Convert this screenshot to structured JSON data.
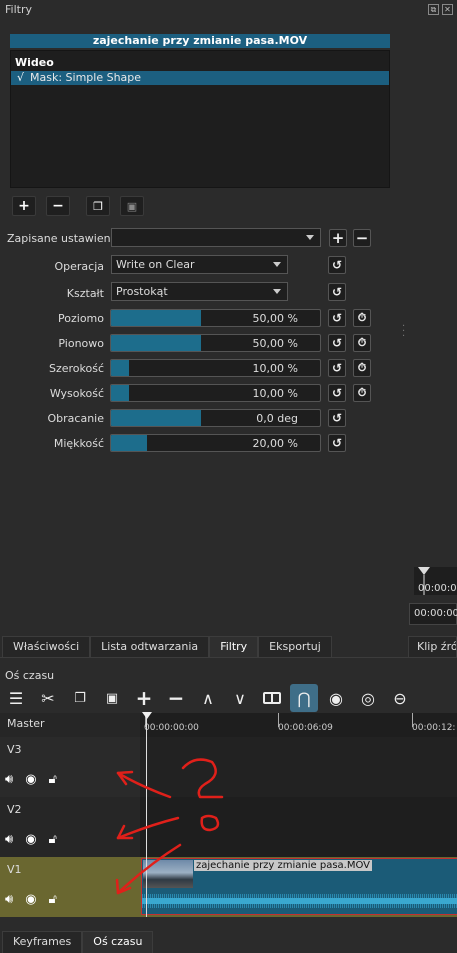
{
  "dock": {
    "title": "Filtry"
  },
  "clip_title": "zajechanie przy zmianie pasa.MOV",
  "filter_list": {
    "section": "Wideo",
    "items": [
      {
        "check": "√",
        "label": "Mask: Simple Shape"
      }
    ]
  },
  "presets": {
    "label": "Zapisane ustawienia",
    "value": ""
  },
  "params": {
    "operation": {
      "label": "Operacja",
      "value": "Write on Clear"
    },
    "shape": {
      "label": "Kształt",
      "value": "Prostokąt"
    },
    "sliders": [
      {
        "label": "Poziomo",
        "value": "50,00 %",
        "fraction": 0.5,
        "keyframe": true
      },
      {
        "label": "Pionowo",
        "value": "50,00 %",
        "fraction": 0.5,
        "keyframe": true
      },
      {
        "label": "Szerokość",
        "value": "10,00 %",
        "fraction": 0.1,
        "keyframe": true
      },
      {
        "label": "Wysokość",
        "value": "10,00 %",
        "fraction": 0.1,
        "keyframe": true
      },
      {
        "label": "Obracanie",
        "value": "0,0 deg",
        "fraction": 0.5,
        "keyframe": false
      },
      {
        "label": "Miękkość",
        "value": "20,00 %",
        "fraction": 0.2,
        "keyframe": false
      }
    ]
  },
  "timecodes": {
    "tc1": "00:00:0",
    "tc2": "00:00:00"
  },
  "bottom_tabs": [
    "Właściwości",
    "Lista odtwarzania",
    "Filtry",
    "Eksportuj",
    "Klip źród"
  ],
  "timeline": {
    "title": "Oś czasu",
    "master_label": "Master",
    "ruler": [
      "00:00:00:00",
      "00:00:06:09",
      "00:00:12:"
    ],
    "tracks": [
      {
        "name": "V3"
      },
      {
        "name": "V2"
      },
      {
        "name": "V1"
      }
    ],
    "clip_label": "zajechanie przy zmianie pasa.MOV",
    "tabs": [
      "Keyframes",
      "Oś czasu"
    ]
  },
  "colors": {
    "accent": "#1c5f80",
    "v1_track": "#6a6730",
    "annotation": "#e0201a"
  }
}
